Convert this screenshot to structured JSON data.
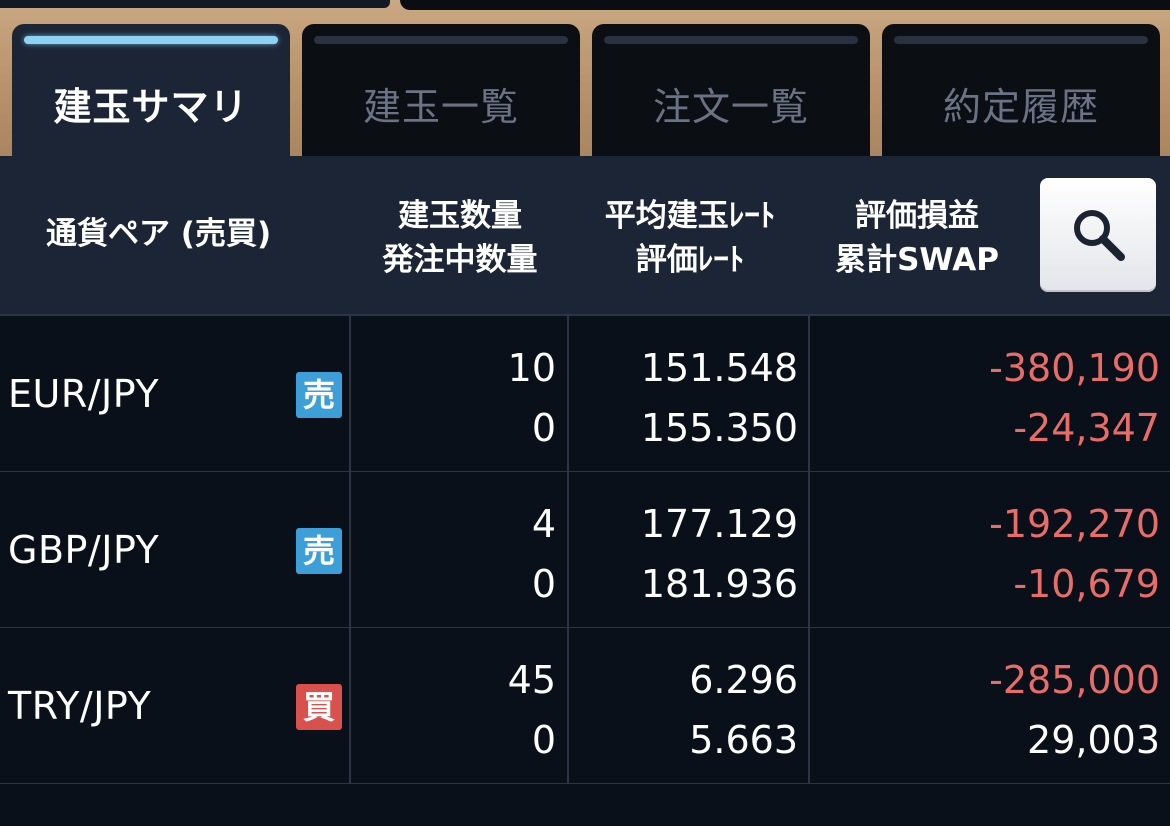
{
  "tabs": [
    {
      "label": "建玉サマリ",
      "active": true
    },
    {
      "label": "建玉一覧",
      "active": false
    },
    {
      "label": "注文一覧",
      "active": false
    },
    {
      "label": "約定履歴",
      "active": false
    }
  ],
  "header": {
    "pair_col": "通貨ペア (売買)",
    "qty_line1": "建玉数量",
    "qty_line2": "発注中数量",
    "rate_line1": "平均建玉ﾚｰﾄ",
    "rate_line2": "評価ﾚｰﾄ",
    "pl_line1": "評価損益",
    "pl_line2": "累計SWAP",
    "search_icon": "search-icon"
  },
  "colors": {
    "sell_badge": "#3c9fd8",
    "buy_badge": "#d9514c",
    "negative": "#e86c68",
    "accent": "#8fd3f4"
  },
  "rows": [
    {
      "pair": "EUR/JPY",
      "side": "売",
      "side_type": "sell",
      "qty": "10",
      "pending_qty": "0",
      "avg_rate": "151.548",
      "eval_rate": "155.350",
      "pl": "-380,190",
      "swap": "-24,347"
    },
    {
      "pair": "GBP/JPY",
      "side": "売",
      "side_type": "sell",
      "qty": "4",
      "pending_qty": "0",
      "avg_rate": "177.129",
      "eval_rate": "181.936",
      "pl": "-192,270",
      "swap": "-10,679"
    },
    {
      "pair": "TRY/JPY",
      "side": "買",
      "side_type": "buy",
      "qty": "45",
      "pending_qty": "0",
      "avg_rate": "6.296",
      "eval_rate": "5.663",
      "pl": "-285,000",
      "swap": "29,003"
    }
  ]
}
